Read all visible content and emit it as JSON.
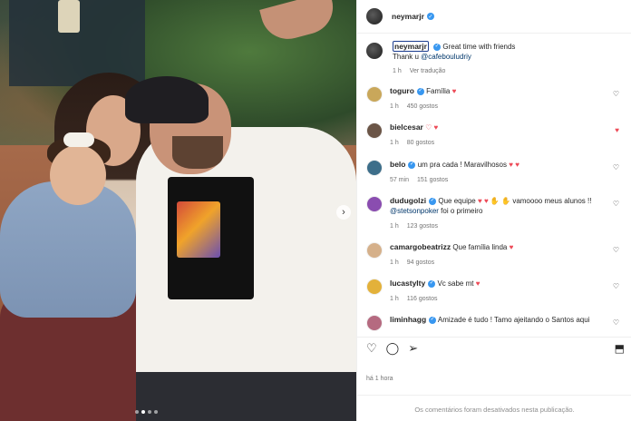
{
  "post": {
    "username": "neymarjr",
    "caption_user": "neymarjr",
    "caption_line1": "Great time with friends",
    "caption_line2_prefix": "Thank u ",
    "caption_mention": "@cafebouludriy",
    "caption_time": "1 h",
    "translate_label": "Ver tradução",
    "carousel_slides": 4,
    "carousel_active": 1
  },
  "comments": [
    {
      "user": "toguro",
      "verified": true,
      "text": "Família",
      "emoji": "♥",
      "time": "1 h",
      "likes": "450 gostos",
      "liked": false,
      "avatar_color": "#c9a75a"
    },
    {
      "user": "bielcesar",
      "verified": false,
      "text": "",
      "emoji": "♡ ♥",
      "time": "1 h",
      "likes": "80 gostos",
      "liked": true,
      "avatar_color": "#6b5547"
    },
    {
      "user": "belo",
      "verified": true,
      "text": "um pra cada ! Maravilhosos",
      "emoji": "♥ ♥",
      "time": "57 min",
      "likes": "151 gostos",
      "liked": false,
      "avatar_color": "#3d6e8a"
    },
    {
      "user": "dudugolzi",
      "verified": true,
      "text": "Que equipe",
      "text2": "vamoooo meus alunos !! ",
      "mention": "@stetsonpoker",
      "text3": " foi o primeiro",
      "emoji": "♥ ♥ ✋ ✋",
      "time": "1 h",
      "likes": "123 gostos",
      "liked": false,
      "avatar_color": "#8a4db0"
    },
    {
      "user": "camargobeatrizz",
      "verified": false,
      "text": "Que família linda",
      "emoji": "♥",
      "time": "1 h",
      "likes": "94 gostos",
      "liked": false,
      "avatar_color": "#d5b08a"
    },
    {
      "user": "lucastylty",
      "verified": true,
      "text": "Vc sabe mt",
      "emoji": "♥",
      "time": "1 h",
      "likes": "116 gostos",
      "liked": false,
      "avatar_color": "#e3b13a"
    },
    {
      "user": "liminhagg",
      "verified": true,
      "text": "Amizade é tudo ! Tamo ajeitando o Santos aqui",
      "emoji": "",
      "time": "",
      "likes": "",
      "liked": false,
      "avatar_color": "#b56a80"
    }
  ],
  "footer": {
    "time_ago": "há 1 hora",
    "disabled_notice": "Os comentários foram desativados nesta publicação."
  },
  "icons": {
    "like": "heart-outline-icon",
    "comment": "comment-icon",
    "share": "send-icon",
    "save": "bookmark-icon",
    "verified": "verified-badge-icon",
    "carousel_next": "chevron-right-icon"
  }
}
